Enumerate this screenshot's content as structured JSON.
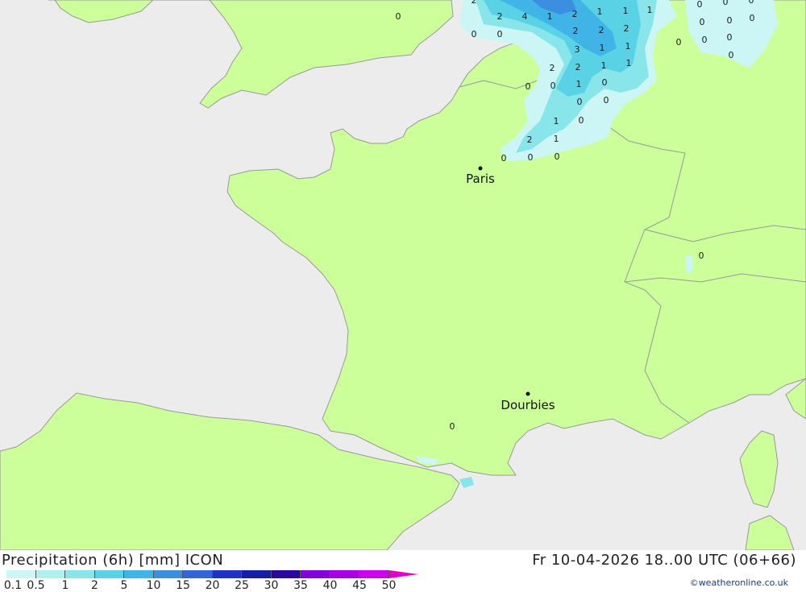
{
  "map": {
    "cities": [
      {
        "name": "Paris"
      },
      {
        "name": "Dourbies"
      }
    ],
    "values": [
      "0",
      "2",
      "0",
      "0",
      "2",
      "4",
      "1",
      "2",
      "1",
      "1",
      "1",
      "0",
      "0",
      "0",
      "0",
      "0",
      "0",
      "0",
      "0",
      "2",
      "2",
      "1",
      "3",
      "1",
      "1",
      "2",
      "2",
      "1",
      "0",
      "1",
      "0",
      "0",
      "0",
      "1",
      "0",
      "2",
      "1",
      "0",
      "0",
      "0",
      "0",
      "0"
    ],
    "colors": {
      "sea": "#ececec",
      "land": "#ccff99",
      "border": "#999999"
    }
  },
  "footer": {
    "title": "Precipitation (6h) [mm] ICON",
    "timestamp": "Fr 10-04-2026 18..00 UTC (06+66)",
    "credit": "©weatheronline.co.uk"
  },
  "legend": {
    "ticks": [
      "0.1",
      "0.5",
      "1",
      "2",
      "5",
      "10",
      "15",
      "20",
      "25",
      "30",
      "35",
      "40",
      "45",
      "50"
    ],
    "colors": [
      "#ccf5f5",
      "#aef0f0",
      "#88e6ea",
      "#5ad2e6",
      "#40b4e6",
      "#3c8fe0",
      "#3264dc",
      "#1e32c8",
      "#141eaa",
      "#2808a0",
      "#8200dc",
      "#a800e6",
      "#d200f0",
      "#e600c8"
    ]
  }
}
